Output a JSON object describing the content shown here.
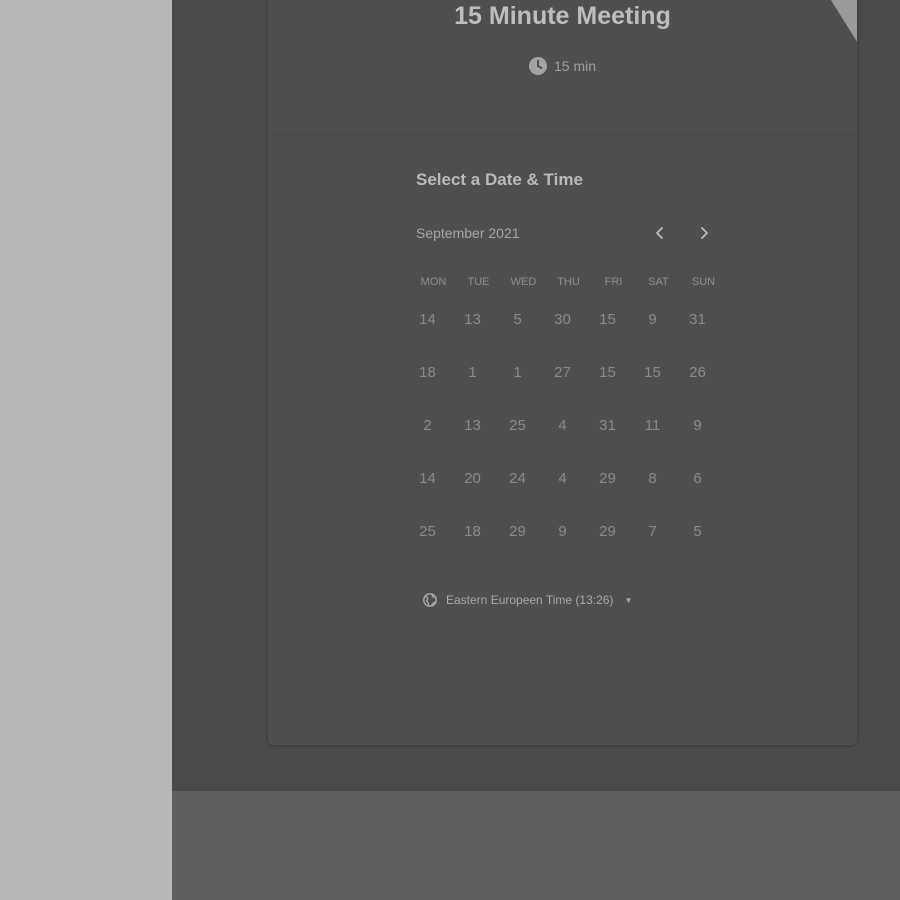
{
  "event": {
    "title": "15 Minute Meeting",
    "duration": "15 min"
  },
  "scheduler": {
    "heading": "Select a Date & Time",
    "month": "September 2021",
    "weekdays": [
      "MON",
      "TUE",
      "WED",
      "THU",
      "FRI",
      "SAT",
      "SUN"
    ],
    "weeks": [
      [
        "14",
        "13",
        "5",
        "30",
        "15",
        "9",
        "31"
      ],
      [
        "18",
        "1",
        "1",
        "27",
        "15",
        "15",
        "26"
      ],
      [
        "2",
        "13",
        "25",
        "4",
        "31",
        "11",
        "9"
      ],
      [
        "14",
        "20",
        "24",
        "4",
        "29",
        "8",
        "6"
      ],
      [
        "25",
        "18",
        "29",
        "9",
        "29",
        "7",
        "5"
      ]
    ],
    "timezone": "Eastern Europeen Time (13:26)"
  },
  "icons": {
    "clock": "clock-icon",
    "prev": "chevron-left-icon",
    "next": "chevron-right-icon",
    "globe": "globe-icon",
    "caret": "caret-down-icon"
  },
  "colors": {
    "page_backdrop": "#b7b7b7",
    "overlay": "#4a4a4a",
    "card": "#4f4f4f",
    "ribbon": "#9a9a9a"
  }
}
